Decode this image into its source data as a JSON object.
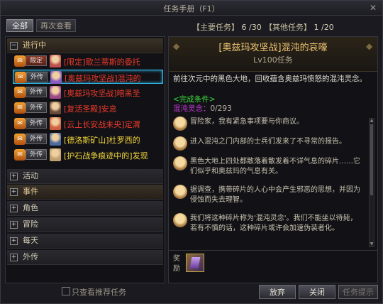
{
  "window": {
    "title": "任务手册（F1）",
    "close_label": "✕"
  },
  "tabs": {
    "all": "全部",
    "review": "再次查看"
  },
  "counters": {
    "main_label": "【主要任务】",
    "main_value": "6 /30",
    "other_label": "【其他任务】",
    "other_value": "1 /20"
  },
  "categories": [
    {
      "label": "进行中",
      "expanded": true,
      "toggle": "−"
    },
    {
      "label": "活动",
      "toggle": "+"
    },
    {
      "label": "事件",
      "toggle": "+"
    },
    {
      "label": "角色",
      "toggle": "+"
    },
    {
      "label": "冒险",
      "toggle": "+"
    },
    {
      "label": "每天",
      "toggle": "+"
    },
    {
      "label": "外传",
      "toggle": "+"
    }
  ],
  "quests": [
    {
      "tag": "限定",
      "title": "[限定]歌兰蒂斯的委托",
      "color": "#ef3a2a",
      "icon_name": "quest-scroll-icon"
    },
    {
      "tag": "外传",
      "title": "[奥兹玛攻坚战]混沌的",
      "color": "#ef3a2a",
      "icon_name": "quest-scroll-icon",
      "selected": true
    },
    {
      "tag": "外传",
      "title": "[奥兹玛攻坚战]暗黑圣",
      "color": "#ef3a2a",
      "icon_name": "quest-scroll-icon"
    },
    {
      "tag": "外传",
      "title": "[复活圣殿]安息",
      "color": "#ef3a2a",
      "icon_name": "quest-scroll-icon"
    },
    {
      "tag": "外传",
      "title": "[云上长安战未央]定渭",
      "color": "#ef3a2a",
      "icon_name": "quest-scroll-icon"
    },
    {
      "tag": "外传",
      "title": "[德洛斯矿山]杜罗西的",
      "color": "#f3d53a",
      "icon_name": "quest-scroll-icon"
    },
    {
      "tag": "外传",
      "title": "[护石战争痕迹中的]发现",
      "color": "#f3d53a",
      "icon_name": "quest-scroll-icon"
    }
  ],
  "filter": {
    "label": "只查看推荐任务",
    "checked": false
  },
  "detail": {
    "title": "[奥兹玛攻坚战]混沌的哀嚎",
    "level": "Lv100任务",
    "description": "前往次元中的黑色大地，回收蕴含奥兹玛愤怒的混沌灵念。",
    "condition_label": "<完成条件>",
    "condition_item": "混沌灵念：",
    "condition_count": "0/293",
    "dialog": [
      "冒险家，我有紧急事项要与你商议。",
      "进入混沌之门内部的士兵们发来了不寻常的报告。",
      "黑色大地上四处都散落着散发着不详气息的碎片……它们似乎和奥兹玛的气息有关。",
      "据调查，携带碎片的人心中会产生邪恶的思想，并因为侵蚀而失去理智。",
      "我们将这种碎片称为'混沌灵念'。我们不能坐以待毙，若有不慎的话，这种碎片或许会加速伪装者化。"
    ],
    "reward_label": "奖励"
  },
  "buttons": {
    "abandon": "放弃",
    "close": "关闭",
    "hint": "任务提示"
  }
}
